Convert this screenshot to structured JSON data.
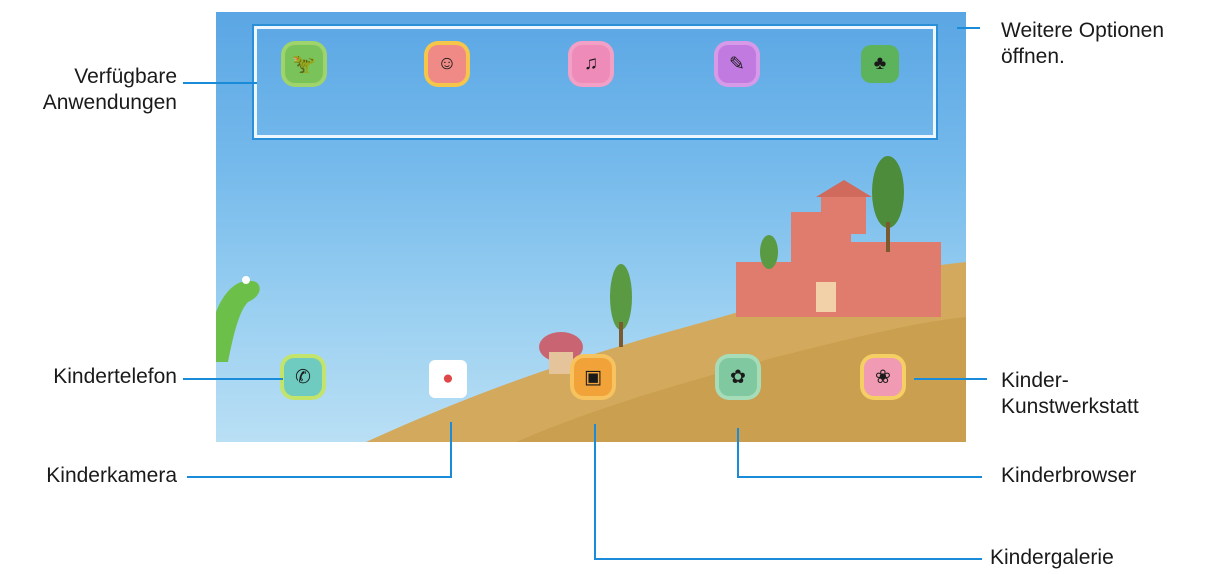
{
  "callouts": {
    "available_apps_line1": "Verfügbare",
    "available_apps_line2": "Anwendungen",
    "more_options_line1": "Weitere Optionen",
    "more_options_line2": "öffnen.",
    "kids_phone": "Kindertelefon",
    "kids_camera": "Kinderkamera",
    "kids_art_line1": "Kinder-",
    "kids_art_line2": "Kunstwerkstatt",
    "kids_browser": "Kinderbrowser",
    "kids_gallery": "Kindergalerie"
  },
  "colors": {
    "callout_line": "#1a8bd8",
    "sky_top": "#5aa6e4",
    "sky_bottom": "#b9dff4",
    "hill": "#d3aa5d",
    "castle": "#e07c6e",
    "tree": "#4d8c3a"
  },
  "top_apps": [
    {
      "icon": "dinosaur-app-icon",
      "name": ""
    },
    {
      "icon": "character-app-icon",
      "name": ""
    },
    {
      "icon": "music-app-icon",
      "name": ""
    },
    {
      "icon": "drawing-app-icon",
      "name": ""
    },
    {
      "icon": "game-app-icon",
      "name": ""
    }
  ],
  "dock_apps": [
    {
      "icon": "phone-icon",
      "name": ""
    },
    {
      "icon": "camera-icon",
      "name": ""
    },
    {
      "icon": "gallery-icon",
      "name": ""
    },
    {
      "icon": "browser-icon",
      "name": ""
    },
    {
      "icon": "art-studio-icon",
      "name": ""
    }
  ]
}
